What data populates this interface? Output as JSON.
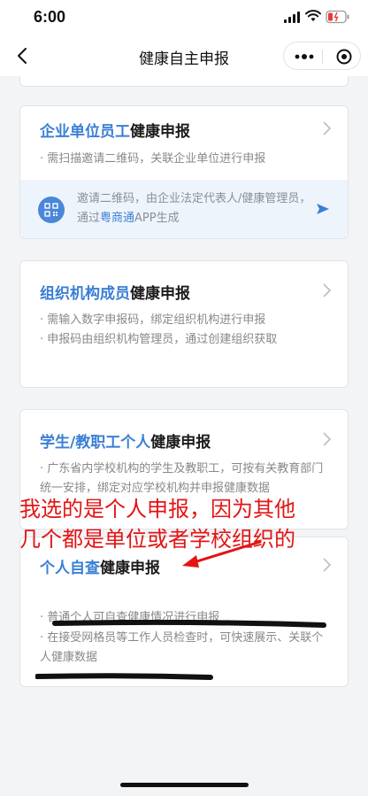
{
  "status_bar": {
    "time": "6:00"
  },
  "nav": {
    "title": "健康自主申报"
  },
  "cards": [
    {
      "title_highlight": "企业单位员工",
      "title_rest": "健康申报",
      "desc": [
        "· 需扫描邀请二维码，关联企业单位进行申报"
      ],
      "invite": {
        "text_before": "邀请二维码，由企业法定代表人/健康管理员，通过",
        "app_name": "粤商通",
        "text_after": "APP生成"
      }
    },
    {
      "title_highlight": "组织机构成员",
      "title_rest": "健康申报",
      "desc": [
        "· 需输入数字申报码，绑定组织机构进行申报",
        "· 申报码由组织机构管理员，通过创建组织获取"
      ]
    },
    {
      "title_highlight": "学生/教职工个人",
      "title_rest": "健康申报",
      "desc": [
        "· 广东省内学校机构的学生及教职工，可按有关教育部门统一安排，绑定对应学校机构并申报健康数据"
      ]
    },
    {
      "title_highlight": "个人自查",
      "title_rest": "健康申报",
      "desc": [
        "· 普通个人可自查健康情况进行申报",
        "· 在接受网格员等工作人员检查时，可快速展示、关联个人健康数据"
      ]
    }
  ],
  "annotation": {
    "line1": "我选的是个人申报，因为其他",
    "line2": "几个都是单位或者学校组织的",
    "color": "#e31414"
  },
  "colors": {
    "accent": "#3a7fd5",
    "invite_bg": "#eef4fc"
  }
}
